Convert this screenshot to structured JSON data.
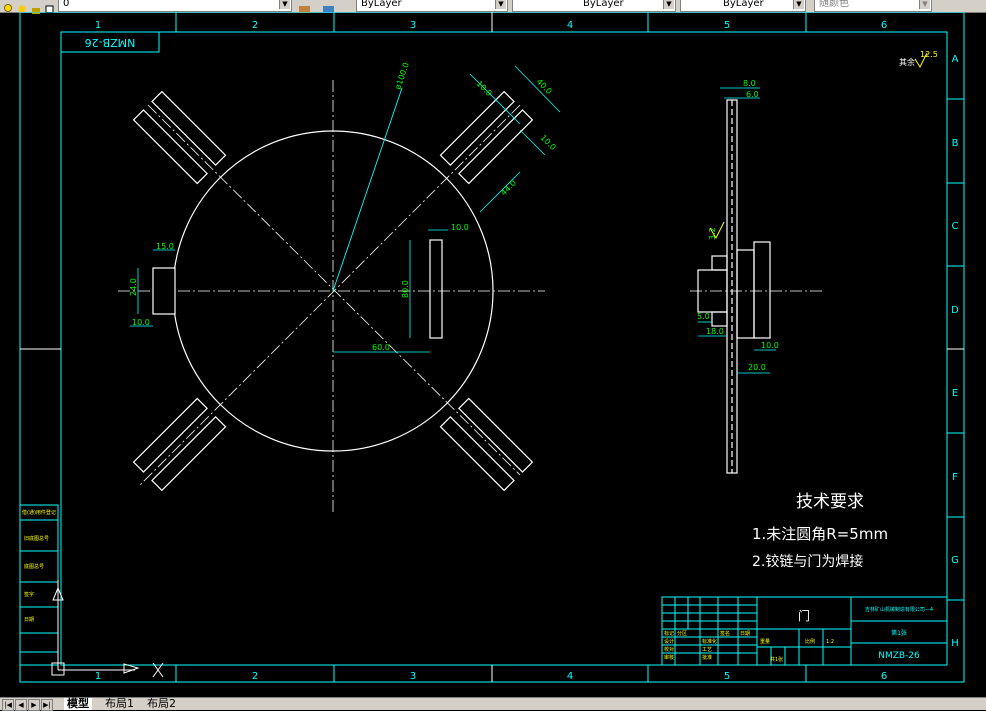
{
  "toolbar": {
    "layer_value": "0",
    "color_value": "ByLayer",
    "linetype_value": "ByLayer",
    "lineweight_value": "ByLayer",
    "plotstyle_value": "随颜色"
  },
  "tabs": {
    "model": "模型",
    "layout1": "布局1",
    "layout2": "布局2"
  },
  "frame": {
    "col_numbers": [
      "1",
      "2",
      "3",
      "4",
      "5",
      "6"
    ],
    "row_letters": [
      "A",
      "B",
      "C",
      "D",
      "E",
      "F",
      "G",
      "H"
    ],
    "corner_code": "NMZB-26"
  },
  "roughness": {
    "value": "12.5",
    "label": "其余"
  },
  "dims_front": {
    "d1": "15.0",
    "d2": "24.0",
    "d3": "10.0",
    "slot_w": "10.0",
    "slot_h": "80.0",
    "offset": "60.0",
    "phi": "ø100.0",
    "a1": "10.0",
    "a2": "40.0",
    "a3": "10.0",
    "a4": "44.0"
  },
  "dims_side": {
    "s1": "8.0",
    "s2": "6.0",
    "s3": "3.2",
    "s4": "5.0",
    "s5": "18.0",
    "s6": "10.0",
    "s7": "20.0"
  },
  "tech": {
    "title": "技术要求",
    "line1": "1.未注圆角R=5mm",
    "line2": "2.铰链与门为焊接"
  },
  "title_block": {
    "part_name": "门",
    "company": "吉林矿山机械制造有限公司—4",
    "drawing_no": "NMZB-26",
    "material": "第1张",
    "scale": "1:2",
    "sheet_total": "共1张",
    "designer": "设计",
    "checker": "校对",
    "approver": "审核",
    "process": "工艺",
    "standard": "标准化",
    "approve2": "批准",
    "weight": "重量",
    "ratio": "比例",
    "date": "日期",
    "sign": "签名",
    "markings": "标记",
    "zones": "分区"
  },
  "side_block": {
    "r1": "借(通)用件登记",
    "r2": "旧底图总号",
    "r3": "底图总号",
    "r4": "签字",
    "r5": "日期"
  },
  "colors": {
    "white": "#ffffff",
    "cyan": "#00ffff",
    "green": "#00ff00",
    "yellow": "#ffff00",
    "bg": "#000000"
  }
}
